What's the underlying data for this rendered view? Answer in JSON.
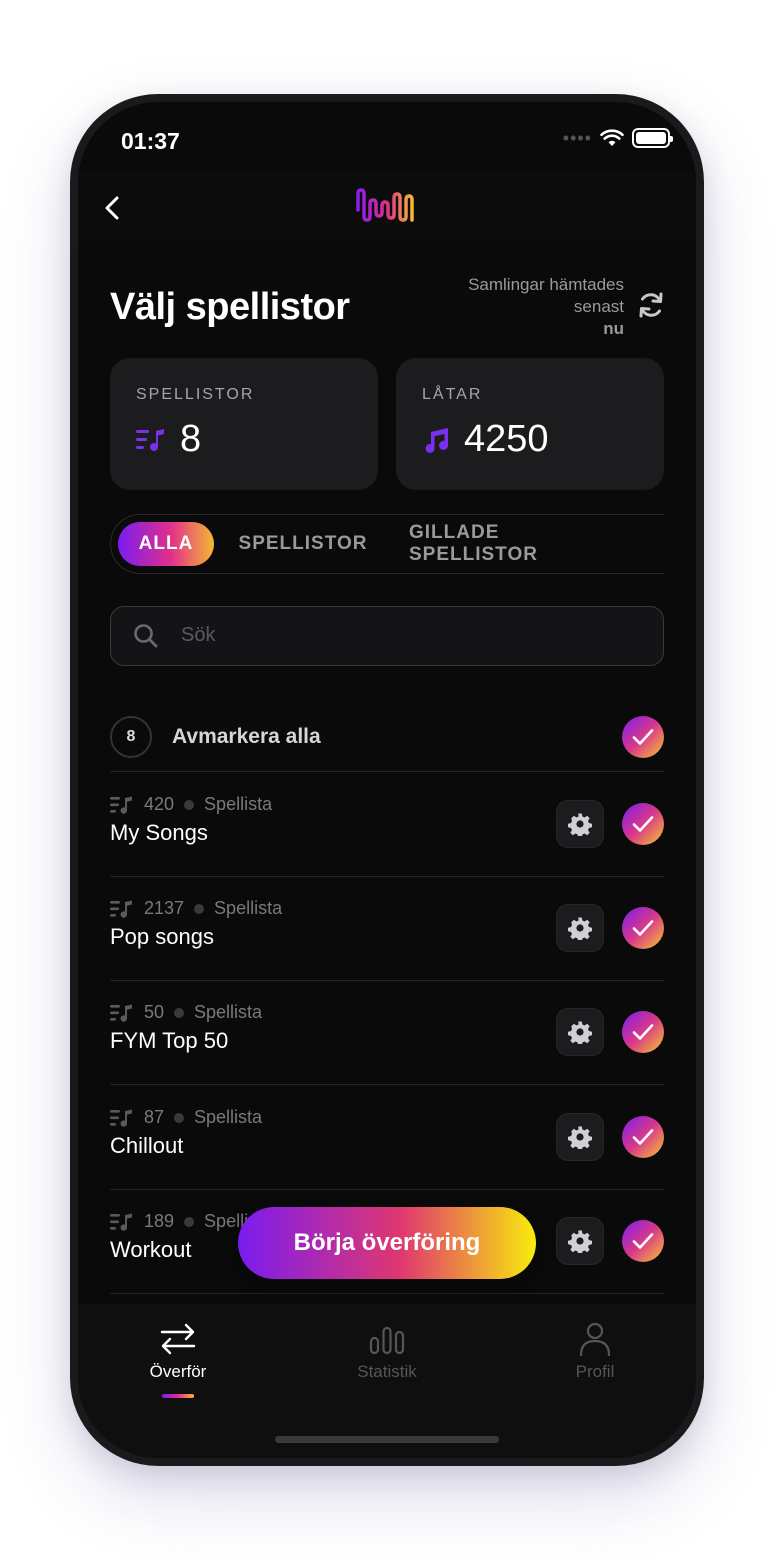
{
  "status_bar": {
    "time": "01:37"
  },
  "header": {
    "title": "Välj spellistor",
    "sync_line1": "Samlingar hämtades",
    "sync_line2": "senast",
    "sync_time": "nu"
  },
  "stats": {
    "playlists": {
      "label": "SPELLISTOR",
      "value": "8"
    },
    "songs": {
      "label": "LÅTAR",
      "value": "4250"
    }
  },
  "tabs": [
    {
      "label": "ALLA",
      "active": true
    },
    {
      "label": "SPELLISTOR",
      "active": false
    },
    {
      "label": "GILLADE SPELLISTOR",
      "active": false
    }
  ],
  "search": {
    "placeholder": "Sök",
    "value": ""
  },
  "select_all": {
    "count": "8",
    "label": "Avmarkera alla",
    "checked": true
  },
  "playlists": [
    {
      "count": "420",
      "type": "Spellista",
      "name": "My Songs",
      "checked": true
    },
    {
      "count": "2137",
      "type": "Spellista",
      "name": "Pop songs",
      "checked": true
    },
    {
      "count": "50",
      "type": "Spellista",
      "name": "FYM Top 50",
      "checked": true
    },
    {
      "count": "87",
      "type": "Spellista",
      "name": "Chillout",
      "checked": true
    },
    {
      "count": "189",
      "type": "Spellista",
      "name": "Workout",
      "checked": true
    }
  ],
  "cta": {
    "label": "Börja överföring"
  },
  "tabbar": [
    {
      "label": "Överför",
      "icon": "transfer-arrows-icon",
      "active": true
    },
    {
      "label": "Statistik",
      "icon": "bar-chart-icon",
      "active": false
    },
    {
      "label": "Profil",
      "icon": "person-icon",
      "active": false
    }
  ],
  "colors": {
    "accent_purple": "#7a1cf0",
    "accent_pink": "#e0308a",
    "accent_yellow": "#f7b733",
    "background": "#0a0a0b",
    "card": "#1c1c1e"
  }
}
